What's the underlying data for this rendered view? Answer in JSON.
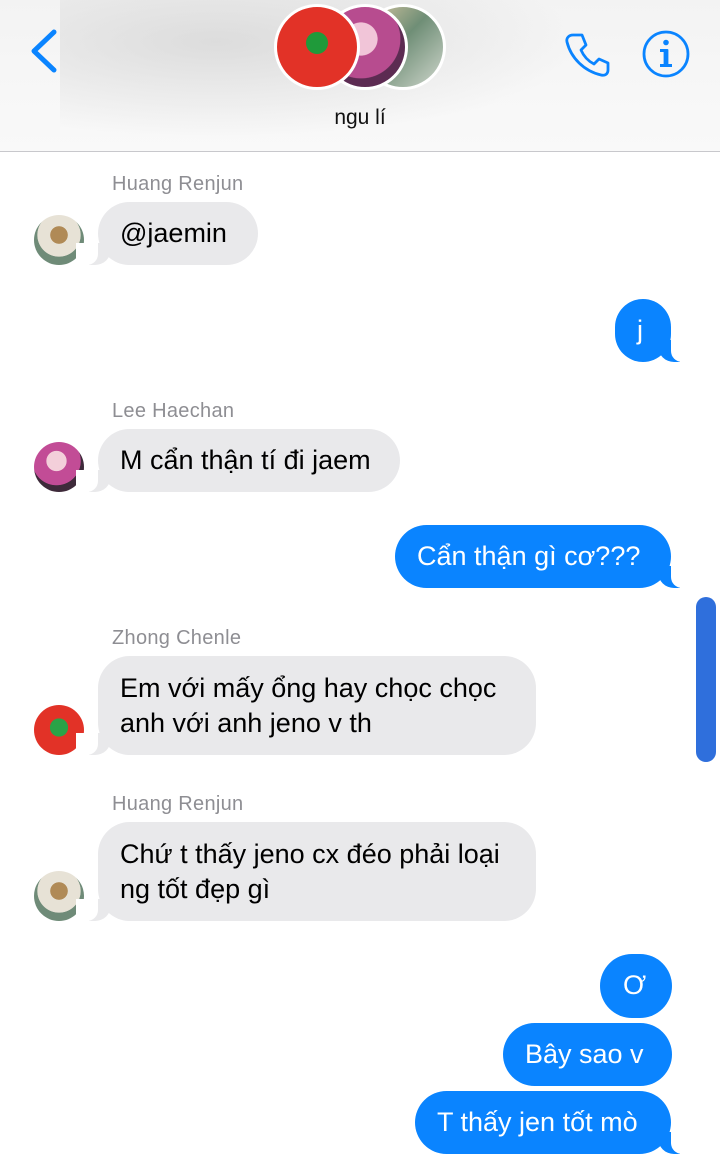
{
  "header": {
    "group_name": "ngu lí",
    "back_icon": "chevron-left-icon",
    "phone_icon": "phone-icon",
    "info_icon": "info-icon",
    "accent_color": "#0a84ff"
  },
  "messages": [
    {
      "direction": "incoming",
      "sender": "Huang Renjun",
      "text": "@jaemin"
    },
    {
      "direction": "outgoing",
      "text": "j"
    },
    {
      "direction": "incoming",
      "sender": "Lee Haechan",
      "text": "M cẩn thận tí đi jaem"
    },
    {
      "direction": "outgoing",
      "text": "Cẩn thận gì cơ???"
    },
    {
      "direction": "incoming",
      "sender": "Zhong Chenle",
      "lines": [
        "Em với mấy ổng hay chọc chọc",
        "anh với anh jeno v th"
      ]
    },
    {
      "direction": "incoming",
      "sender": "Huang Renjun",
      "lines": [
        "Chứ t thấy jeno cx đéo phải loại",
        "ng tốt đẹp gì"
      ]
    },
    {
      "direction": "outgoing",
      "text": "Ơ"
    },
    {
      "direction": "outgoing",
      "text": "Bây sao v"
    },
    {
      "direction": "outgoing",
      "text": "T thấy jen tốt mò"
    }
  ],
  "colors": {
    "incoming_bubble": "#e9e9eb",
    "outgoing_bubble": "#0a84ff",
    "scrollbar": "#2f6fdc"
  }
}
